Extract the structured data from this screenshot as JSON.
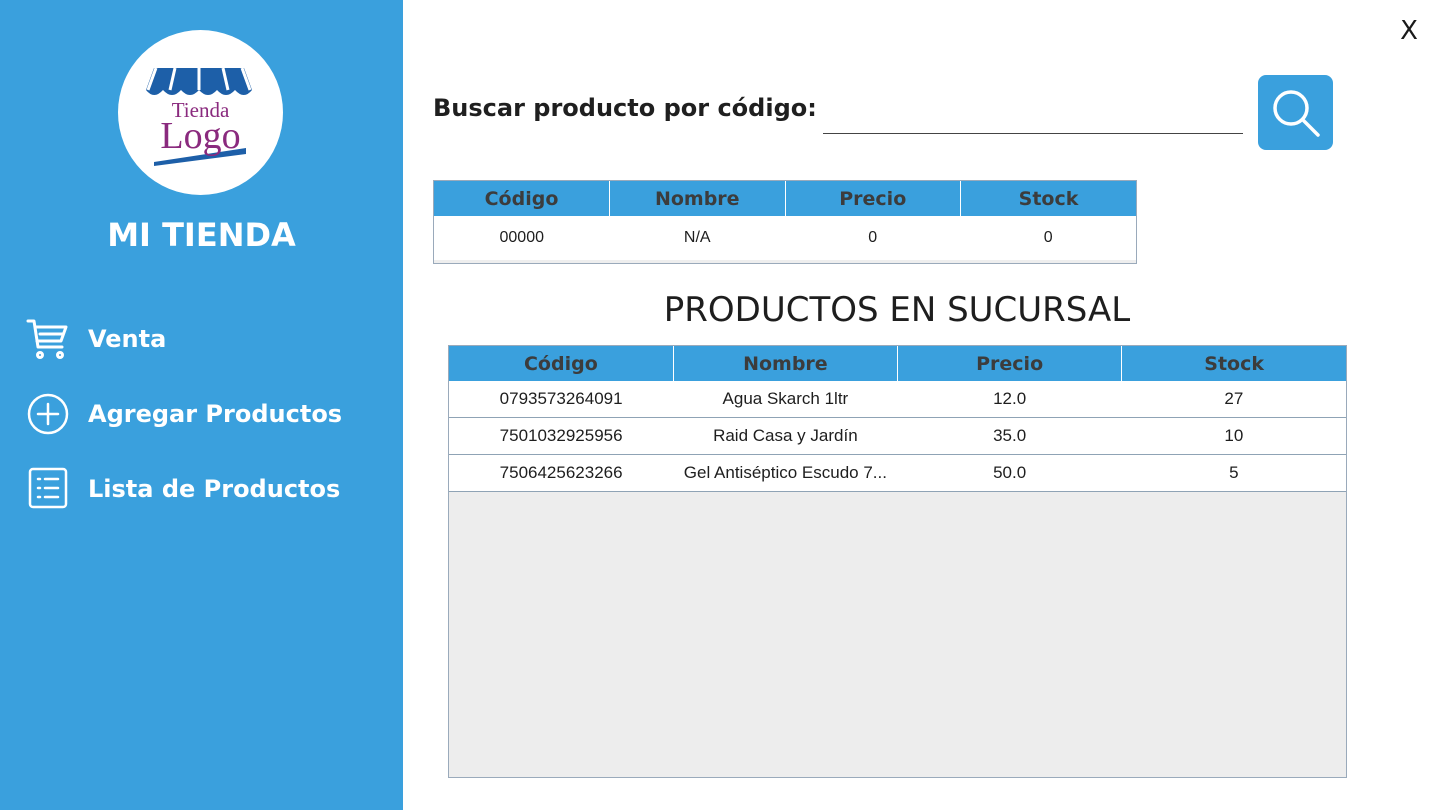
{
  "sidebar": {
    "logo": {
      "line1": "Tienda",
      "line2": "Logo"
    },
    "store_name": "MI TIENDA",
    "items": [
      {
        "label": "Venta",
        "icon": "cart-icon"
      },
      {
        "label": "Agregar Productos",
        "icon": "plus-circle-icon"
      },
      {
        "label": "Lista de Productos",
        "icon": "list-icon"
      }
    ]
  },
  "window": {
    "close_label": "X"
  },
  "search": {
    "label": "Buscar producto por código:",
    "value": "",
    "button_icon": "search-icon"
  },
  "result_table": {
    "headers": [
      "Código",
      "Nombre",
      "Precio",
      "Stock"
    ],
    "row": [
      "00000",
      "N/A",
      "0",
      "0"
    ]
  },
  "products": {
    "title": "PRODUCTOS EN SUCURSAL",
    "headers": [
      "Código",
      "Nombre",
      "Precio",
      "Stock"
    ],
    "rows": [
      [
        "0793573264091",
        "Agua Skarch 1ltr",
        "12.0",
        "27"
      ],
      [
        "7501032925956",
        "Raid Casa y Jardín",
        "35.0",
        "10"
      ],
      [
        "7506425623266",
        "Gel Antiséptico Escudo 7...",
        "50.0",
        "5"
      ]
    ]
  },
  "colors": {
    "accent": "#3aa0dd",
    "logo_awning": "#1d5fa8",
    "logo_text": "#8a2a7e"
  }
}
